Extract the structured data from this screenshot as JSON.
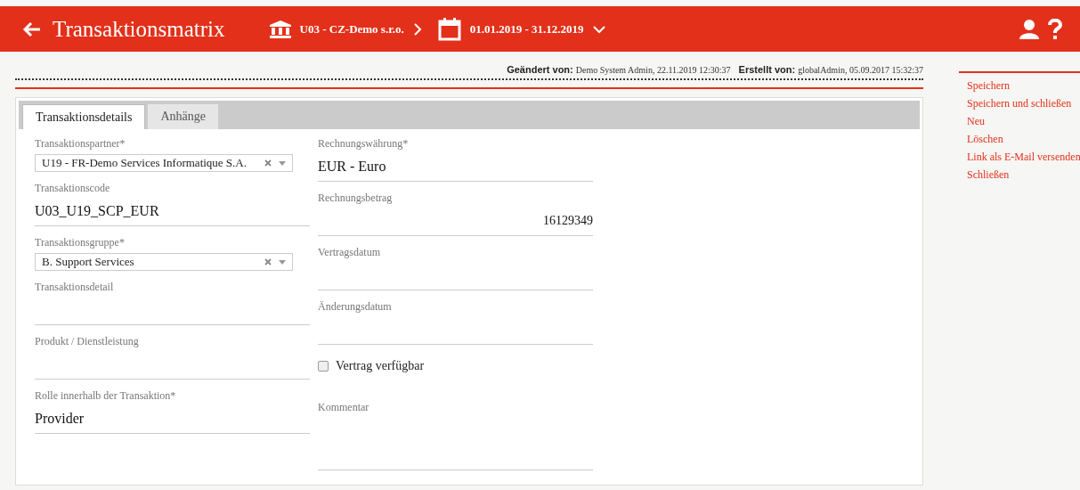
{
  "header": {
    "title": "Transaktionsmatrix",
    "company": "U03 - CZ-Demo s.r.o.",
    "period": "01.01.2019 - 31.12.2019"
  },
  "audit": [
    {
      "label": "Geändert von:",
      "value": "Demo System Admin, 22.11.2019 12:30:37"
    },
    {
      "label": "Erstellt von:",
      "value": "globalAdmin, 05.09.2017 15:32:37"
    }
  ],
  "tabs": [
    {
      "label": "Transaktionsdetails",
      "selected": true
    },
    {
      "label": "Anhänge",
      "selected": false
    }
  ],
  "columns": [
    {
      "fields": [
        {
          "kind": "select",
          "label": "Transaktionspartner*",
          "value": "U19 - FR-Demo Services Informatique S.A."
        },
        {
          "kind": "text",
          "label": "Transaktionscode",
          "value": "U03_U19_SCP_EUR"
        },
        {
          "kind": "select",
          "label": "Transaktionsgruppe*",
          "value": "B. Support Services"
        },
        {
          "kind": "text",
          "label": "Transaktionsdetail"
        },
        {
          "kind": "text",
          "label": "Produkt / Dienstleistung"
        },
        {
          "kind": "text",
          "label": "Rolle innerhalb der Transaktion*",
          "value": "Provider"
        }
      ]
    },
    {
      "fields": [
        {
          "kind": "text",
          "label": "Rechnungswährung*",
          "value": "EUR - Euro"
        },
        {
          "kind": "number",
          "label": "Rechnungsbetrag",
          "value": "16129349"
        },
        {
          "kind": "text",
          "label": "Vertragsdatum"
        },
        {
          "kind": "text",
          "label": "Änderungsdatum"
        },
        {
          "kind": "checkbox",
          "label": "Vertrag verfügbar",
          "checked": false
        },
        {
          "kind": "textarea",
          "label": "Kommentar"
        }
      ]
    }
  ],
  "actions": [
    "Speichern",
    "Speichern und schließen",
    "Neu",
    "Löschen",
    "Link als E-Mail versenden",
    "Schließen"
  ]
}
